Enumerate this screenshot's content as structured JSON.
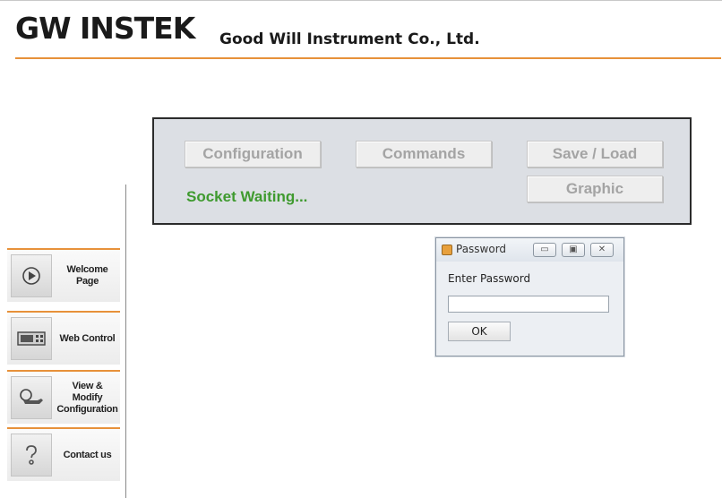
{
  "header": {
    "logo": "GW INSTEK",
    "company": "Good Will Instrument Co., Ltd.",
    "accent_color": "#e7913a"
  },
  "panel": {
    "buttons": {
      "configuration": "Configuration",
      "commands": "Commands",
      "save_load": "Save / Load",
      "graphic": "Graphic"
    },
    "status": "Socket Waiting...",
    "status_color": "#3f9a2f"
  },
  "sidebar": {
    "items": [
      {
        "label_lines": [
          "Welcome Page"
        ],
        "icon": "play-icon"
      },
      {
        "label_lines": [
          "Web Control"
        ],
        "icon": "instrument-icon"
      },
      {
        "label_lines": [
          "View & Modify",
          "Configuration"
        ],
        "icon": "hand-pointer-icon"
      },
      {
        "label_lines": [
          "Contact us"
        ],
        "icon": "question-icon"
      }
    ]
  },
  "dialog": {
    "title": "Password",
    "prompt": "Enter Password",
    "password_value": "",
    "ok_label": "OK",
    "window_buttons": {
      "minimize": "▭",
      "maximize": "▣",
      "close": "✕"
    }
  }
}
